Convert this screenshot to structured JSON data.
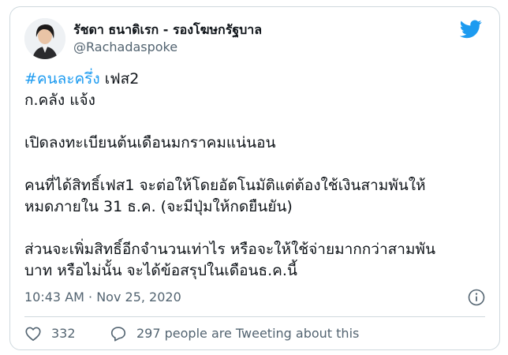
{
  "author": {
    "display_name": "รัชดา ธนาดิเรก - รองโฆษกรัฐบาล",
    "handle": "@Rachadaspoke"
  },
  "tweet": {
    "hashtag": "#คนละครึ่ง",
    "line1_rest": " เฟส2",
    "line2": "ก.คลัง แจ้ง",
    "line3": "เปิดลงทะเบียนต้นเดือนมกราคมแน่นอน",
    "line4": "คนที่ได้สิทธิ์เฟส1 จะต่อให้โดยอัตโนมัติแต่ต้องใช้เงินสามพันให้",
    "line5": "หมดภายใน 31 ธ.ค. (จะมีปุ่มให้กดยืนยัน)",
    "line6": "ส่วนจะเพิ่มสิทธิ์อีกจำนวนเท่าไร หรือจะให้ใช้จ่ายมากกว่าสามพัน",
    "line7": "บาท หรือไม่นั้น จะได้ข้อสรุปในเดือนธ.ค.นี้",
    "timestamp": "10:43 AM · Nov 25, 2020"
  },
  "actions": {
    "likes": "332",
    "retweet_text": "297 people are Tweeting about this"
  },
  "colors": {
    "accent": "#1d9bf0",
    "text": "#0f1419",
    "muted": "#536471",
    "border": "#cfd9de"
  },
  "icons": {
    "brand": "twitter-bird-icon",
    "info": "info-icon",
    "like": "heart-icon",
    "reply": "speech-bubble-icon"
  }
}
